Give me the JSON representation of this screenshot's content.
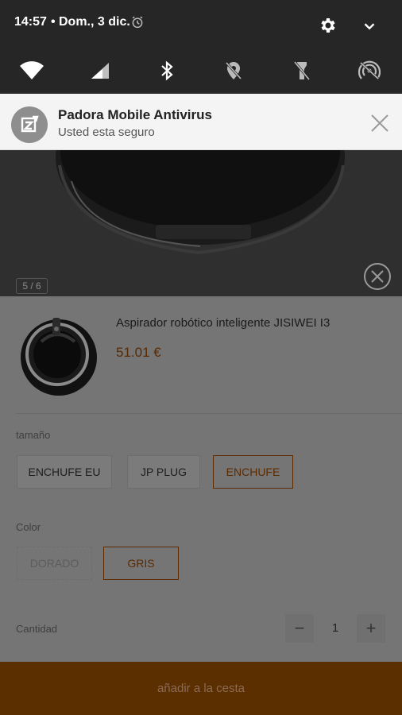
{
  "status_bar": {
    "time": "14:57",
    "separator": "•",
    "date": "Dom., 3 dic."
  },
  "quick_tiles": [
    "wifi-icon",
    "signal-icon",
    "bluetooth-icon",
    "location-off-icon",
    "flashlight-off-icon",
    "hotspot-off-icon"
  ],
  "notification": {
    "title": "Padora Mobile Antivirus",
    "subtitle": "Usted esta seguro"
  },
  "gallery": {
    "counter": "5 / 6"
  },
  "product": {
    "name": "Aspirador robótico inteligente JISIWEI I3",
    "price": "51.01 €"
  },
  "size": {
    "label": "tamaño",
    "options": [
      "ENCHUFE EU",
      "JP PLUG",
      "ENCHUFE"
    ],
    "selected": "ENCHUFE"
  },
  "color": {
    "label": "Color",
    "options": [
      "DORADO",
      "GRIS"
    ],
    "selected": "GRIS"
  },
  "quantity": {
    "label": "Cantidad",
    "value": "1",
    "minus": "−",
    "plus": "+"
  },
  "cta": {
    "label": "añadir a la cesta"
  },
  "colors": {
    "accent": "#5c2b00",
    "overlay": "#757575"
  }
}
